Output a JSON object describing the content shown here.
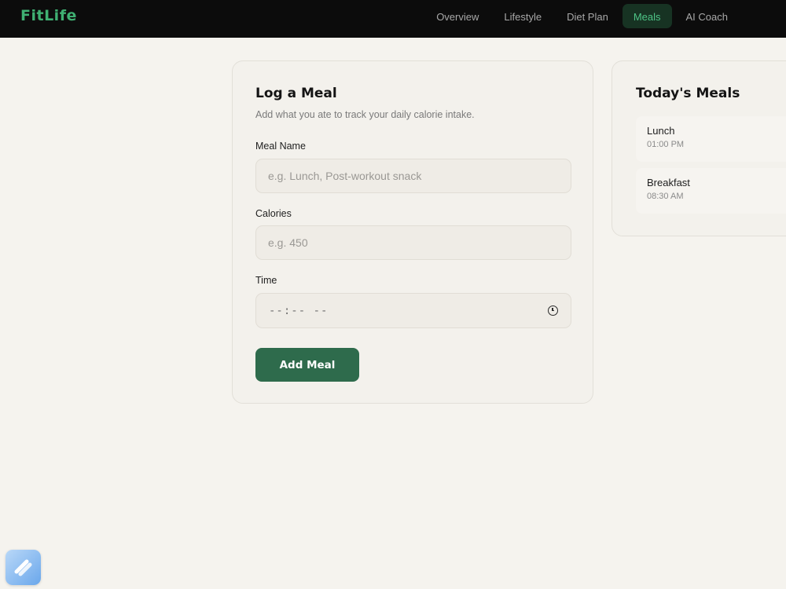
{
  "brand": {
    "name": "FitLife",
    "color": "#3fb072"
  },
  "nav": {
    "items": [
      {
        "label": "Overview",
        "active": false
      },
      {
        "label": "Lifestyle",
        "active": false
      },
      {
        "label": "Diet Plan",
        "active": false
      },
      {
        "label": "Meals",
        "active": true
      },
      {
        "label": "AI Coach",
        "active": false
      }
    ],
    "active_color": "#4ec487"
  },
  "log_meal": {
    "title": "Log a Meal",
    "subtitle": "Add what you ate to track your daily calorie intake.",
    "meal_name_label": "Meal Name",
    "meal_name_placeholder": "e.g. Lunch, Post-workout snack",
    "meal_name_value": "",
    "calories_label": "Calories",
    "calories_placeholder": "e.g. 450",
    "calories_value": "",
    "time_label": "Time",
    "time_placeholder": "--:-- --",
    "time_icon": "clock-icon",
    "submit_label": "Add Meal",
    "accent": "#2e6b4c"
  },
  "todays_meals": {
    "title": "Today's Meals",
    "items": [
      {
        "name": "Lunch",
        "time": "01:00 PM"
      },
      {
        "name": "Breakfast",
        "time": "08:30 AM"
      }
    ]
  },
  "corner_app": {
    "icon": "app-launcher-icon"
  }
}
